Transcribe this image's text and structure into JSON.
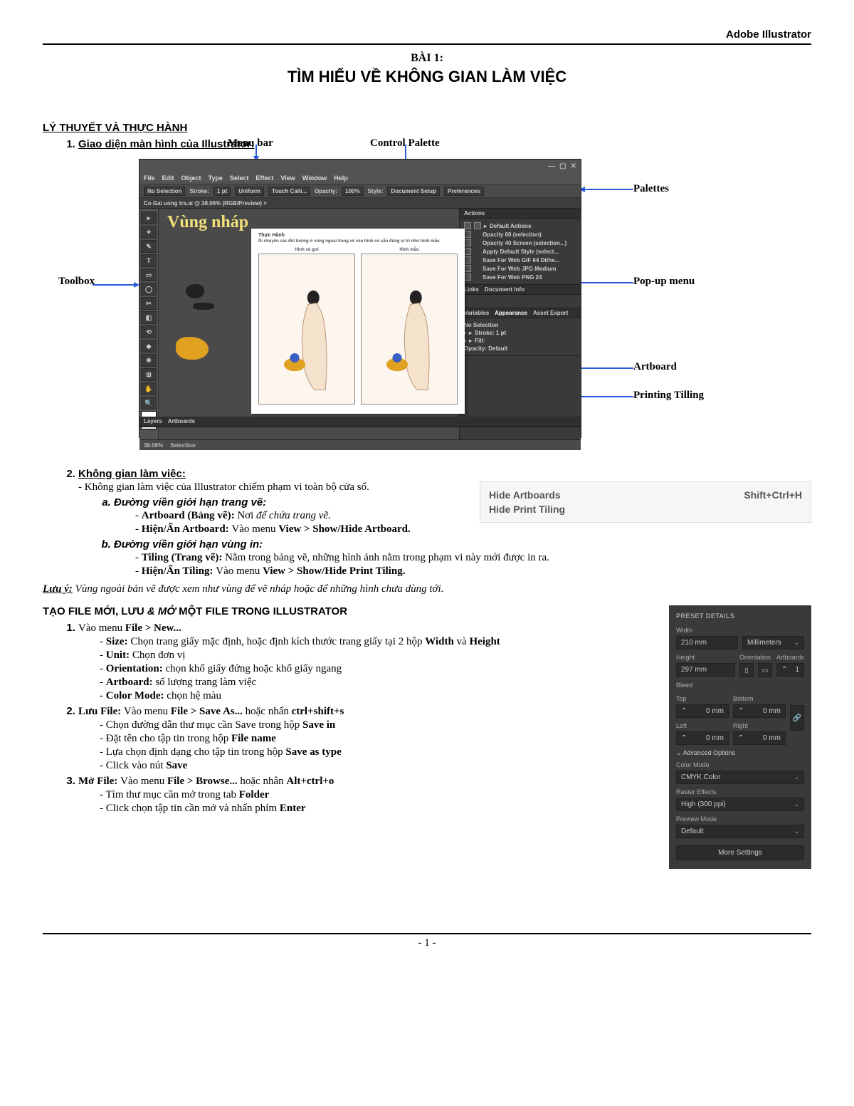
{
  "header": {
    "app_name": "Adobe Illustrator"
  },
  "lesson": {
    "number": "BÀI 1:",
    "title": "TÌM HIỂU VỀ KHÔNG GIAN LÀM VIỆC"
  },
  "s1": {
    "heading": "LÝ THUYẾT VÀ THỰC HÀNH",
    "item1_title": "Giao diện màn hình của Illustrator:",
    "item2_title": "Không gian làm việc:",
    "item2_desc": "- Không gian làm việc của Illustrator chiếm phạm vi toàn bộ cửa sổ.",
    "a_title": "Đường viền giới hạn trang vẽ:",
    "a1_pre": "Artboard (Bảng vẽ): ",
    "a1_body": "Nơi ",
    "a1_ital": "để chứa trang vẽ.",
    "a2_pre": "Hiện/Ẩn Artboard: ",
    "a2_body": "Vào menu ",
    "a2_bold": "View > Show/Hide Artboard.",
    "b_title": "Đường viền giới hạn vùng in:",
    "b1_pre": "Tiling (Trang vẽ): ",
    "b1_body": "Nằm trong bảng vẽ, những hình ảnh nằm trong phạm vi này mới được in ra.",
    "b2_pre": "Hiện/Ẩn Tiling: ",
    "b2_body": "Vào menu ",
    "b2_bold": "View > Show/Hide Print Tiling."
  },
  "note": {
    "label": "Lưu ý:",
    "text": " Vùng ngoài bản vẽ được xem như vùng để vẽ nháp hoặc để những hình chưa dùng tới."
  },
  "hide_panel": {
    "r1_left": "Hide Artboards",
    "r1_right": "Shift+Ctrl+H",
    "r2_left": "Hide Print Tiling"
  },
  "s2": {
    "heading_pre": "TẠO FILE MỚI, LƯU ",
    "heading_ital": "& MỞ",
    "heading_post": " MỘT FILE TRONG ILLUSTRATOR",
    "n1_label": "Vào menu ",
    "n1_bold": "File > New...",
    "n1_a_pre": "Size: ",
    "n1_a_body": "Chọn trang giấy mặc định, hoặc định kích thước trang giấy tại 2 hộp ",
    "n1_a_b1": "Width",
    "n1_a_mid": " và ",
    "n1_a_b2": "Height",
    "n1_b_pre": "Unit: ",
    "n1_b_body": "Chọn đơn vị",
    "n1_c_pre": "Orientation: ",
    "n1_c_body": "chọn khổ giấy đứng hoặc khổ giấy ngang",
    "n1_d_pre": "Artboard: ",
    "n1_d_body": "số lượng trang làm việc",
    "n1_e_pre": "Color Mode: ",
    "n1_e_body": "chọn hệ màu",
    "n2_pre": "Lưu File: ",
    "n2_body": "Vào menu ",
    "n2_b1": "File > Save As... ",
    "n2_mid": "hoặc nhấn ",
    "n2_b2": "ctrl+shift+s",
    "n2_a": "Chọn đường dẫn thư mục cần Save trong hộp ",
    "n2_a_b": "Save in",
    "n2_b_body": "Đặt tên cho tập tin trong hộp ",
    "n2_b_b": "File name",
    "n2_c_body": "Lựa chọn định dạng cho tập tin trong hộp ",
    "n2_c_b": "Save as type",
    "n2_d_body": "Click vào nút ",
    "n2_d_b": "Save",
    "n3_pre": "Mở File: ",
    "n3_body": "Vào menu ",
    "n3_b1": "File > Browse... ",
    "n3_mid": "hoặc nhân ",
    "n3_b2": "Alt+ctrl+o",
    "n3_a": "Tìm thư mục cần mở trong tab ",
    "n3_a_b": "Folder",
    "n3_b_body": "Click chọn tập tin cần mở và nhấn phím ",
    "n3_b_b": "Enter"
  },
  "fig": {
    "menu_bar": "Menu bar",
    "control_palette": "Control Palette",
    "toolbox": "Toolbox",
    "palettes": "Palettes",
    "popup": "Pop-up menu",
    "artboard": "Artboard",
    "tiling": "Printing Tilling",
    "scratch": "Vùng nháp",
    "doc_tab": "Co Gai uong tra.ai @ 38.06% (RGB/Preview) ×",
    "menus": [
      "File",
      "Edit",
      "Object",
      "Type",
      "Select",
      "Effect",
      "View",
      "Window",
      "Help"
    ],
    "control_items": [
      "No Selection",
      "Stroke:",
      "1 pt",
      "Uniform",
      "Touch Calli...",
      "Opacity:",
      "100%",
      "Style:",
      "Document Setup",
      "Preferences"
    ],
    "status_zoom": "38.06%",
    "status_sel": "Selection",
    "actions_tab": "Actions",
    "actions": [
      "Default Actions",
      "Opacity 60 (selection)",
      "Opacity 40 Screen (selection...)",
      "Apply Default Style (select...",
      "Save For Web GIF 64 Dithe...",
      "Save For Web JPG Medium",
      "Save For Web PNG 24"
    ],
    "links_tabs": [
      "Links",
      "Document Info"
    ],
    "appear_tabs": [
      "Variables",
      "Appearance",
      "Asset Export"
    ],
    "appear_rows": [
      "No Selection",
      "Stroke:   1 pt",
      "Fill:",
      "Opacity: Default"
    ],
    "bottom_tabs": [
      "Layers",
      "Artboards"
    ],
    "artboard_hdr": "Thực Hành",
    "artboard_sub": "Di chuyển các đối tượng ở vùng ngoài trang vẽ vào hình có sẵn đúng vị trí như hình mẫu",
    "left_cap": "Hình có gợi",
    "right_cap": "Hình mẫu"
  },
  "preset": {
    "title": "PRESET DETAILS",
    "width_lbl": "Width",
    "width_val": "210 mm",
    "unit": "Millimeters",
    "height_lbl": "Height",
    "height_val": "297 mm",
    "orient_lbl": "Orientation",
    "artboards_lbl": "Artboards",
    "artboards_val": "1",
    "bleed_lbl": "Bleed",
    "top": "Top",
    "bottom": "Bottom",
    "left": "Left",
    "right": "Right",
    "zero": "0 mm",
    "adv": "Advanced Options",
    "colormode_lbl": "Color Mode",
    "colormode_val": "CMYK Color",
    "raster_lbl": "Raster Effects",
    "raster_val": "High (300 ppi)",
    "preview_lbl": "Preview Mode",
    "preview_val": "Default",
    "more": "More Settings"
  },
  "page_number": "- 1 -"
}
